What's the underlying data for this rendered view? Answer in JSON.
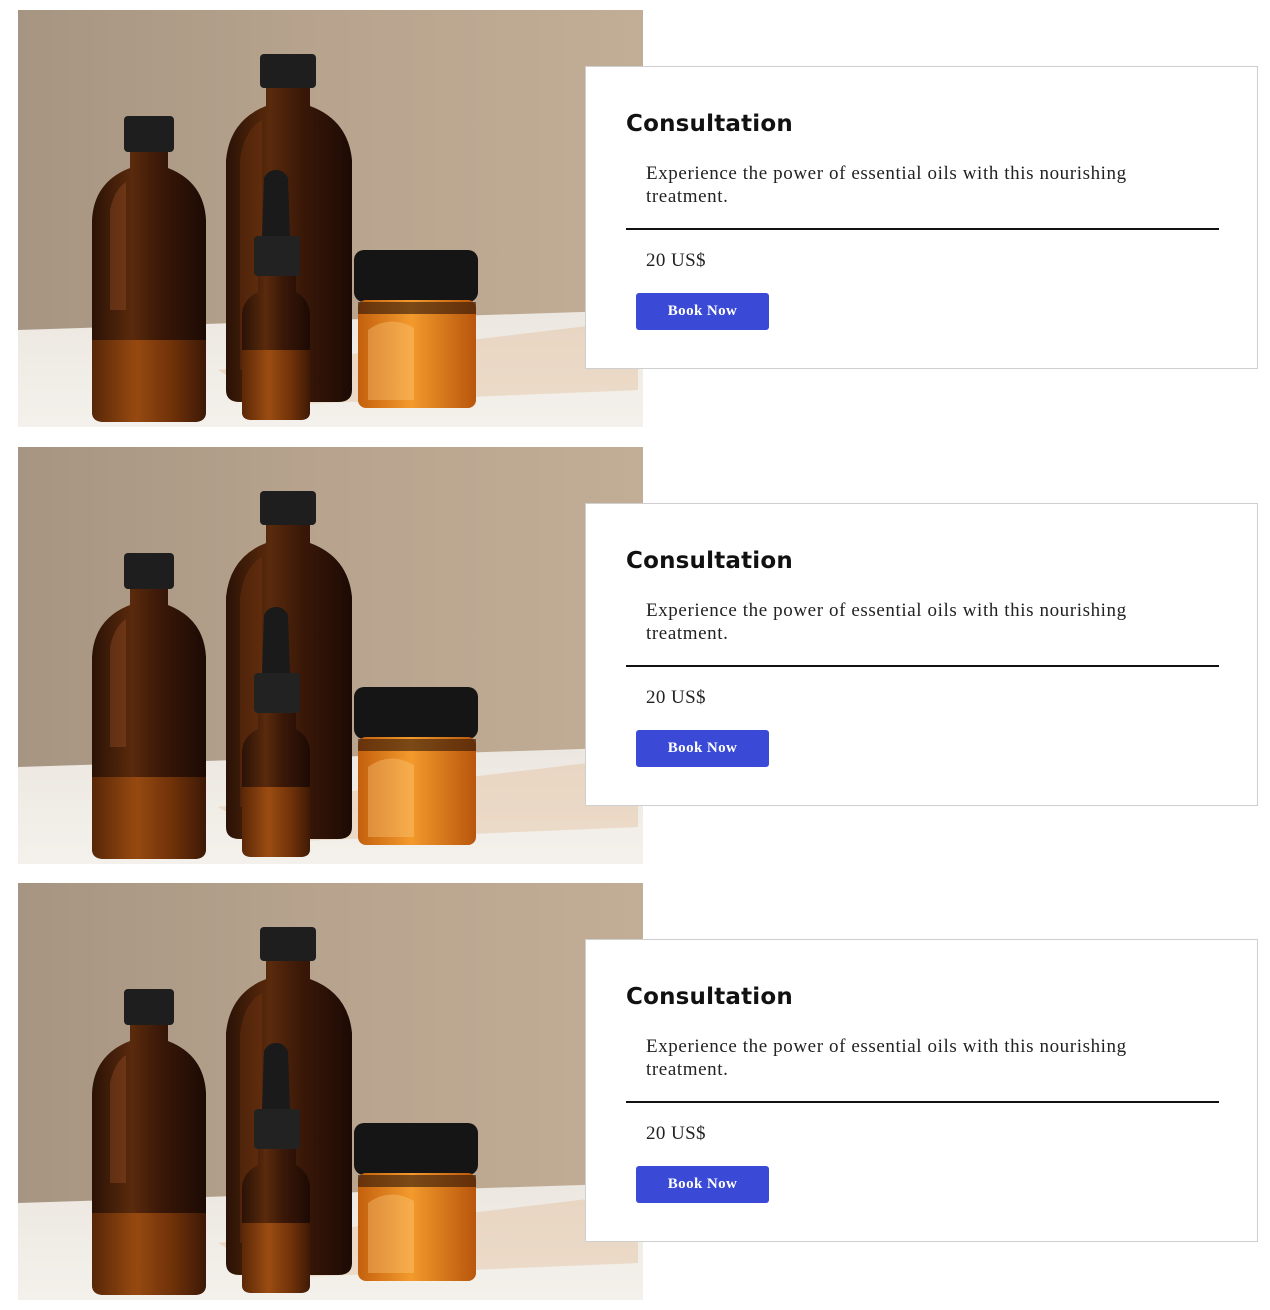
{
  "services": [
    {
      "title": "Consultation",
      "description": "Experience the power of essential oils with this nourishing treatment.",
      "price": "20 US$",
      "button_label": "Book Now",
      "image_icon": "essential-oil-bottles-photo"
    },
    {
      "title": "Consultation",
      "description": "Experience the power of essential oils with this nourishing treatment.",
      "price": "20 US$",
      "button_label": "Book Now",
      "image_icon": "essential-oil-bottles-photo"
    },
    {
      "title": "Consultation",
      "description": "Experience the power of essential oils with this nourishing treatment.",
      "price": "20 US$",
      "button_label": "Book Now",
      "image_icon": "essential-oil-bottles-photo"
    }
  ],
  "colors": {
    "button": "#3a49d6",
    "card_border": "#cfcfcf",
    "divider": "#111111"
  }
}
